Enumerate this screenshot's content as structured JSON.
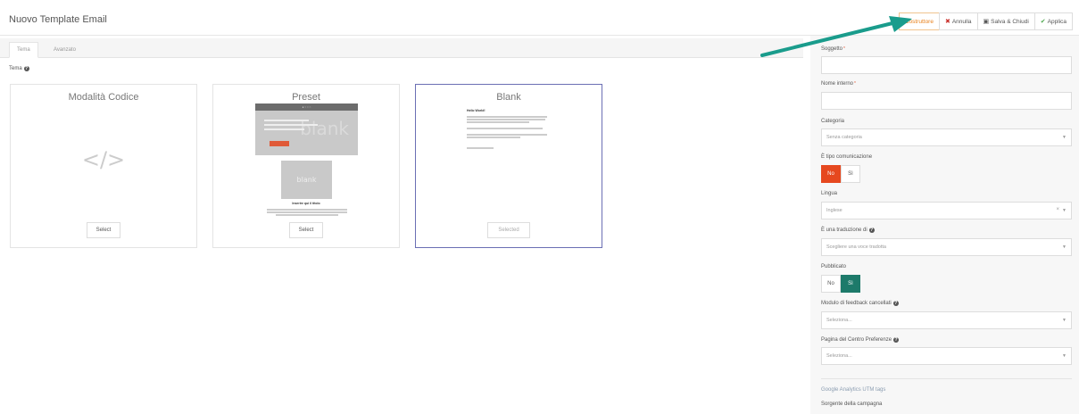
{
  "header": {
    "title": "Nuovo Template Email",
    "buttons": {
      "builder": "Costruttore",
      "cancel": "Annulla",
      "save_close": "Salva & Chiudi",
      "apply": "Applica"
    }
  },
  "tabs": [
    "Tema",
    "Avanzato"
  ],
  "theme_label": "Tema",
  "cards": [
    {
      "title": "Modalità Codice",
      "button": "Select"
    },
    {
      "title": "Preset",
      "button": "Select",
      "hero_text": "blank",
      "image_text": "blank",
      "heading": "Inserire qui il titolo"
    },
    {
      "title": "Blank",
      "button": "Selected",
      "heading": "Hello World!"
    }
  ],
  "form": {
    "subject_label": "Soggetto",
    "subject_value": "",
    "internal_name_label": "Nome interno",
    "internal_name_value": "",
    "category_label": "Categoria",
    "category_value": "Senza categoria",
    "comm_type_label": "È tipo comunicazione",
    "comm_type_no": "No",
    "comm_type_yes": "Sì",
    "language_label": "Lingua",
    "language_value": "Inglese",
    "translation_label": "È una traduzione di",
    "translation_placeholder": "Scegliere una voce tradotta",
    "published_label": "Pubblicato",
    "published_no": "No",
    "published_yes": "Sì",
    "unsub_label": "Modulo di feedback cancellati",
    "unsub_placeholder": "Seleziona...",
    "pref_label": "Pagina del Centro Preferenze",
    "pref_placeholder": "Seleziona...",
    "utm_label": "Google Analytics UTM tags",
    "source_label": "Sorgente della campagna"
  },
  "colors": {
    "builder_accent": "#e8811b",
    "toggle_no_active": "#e6481f",
    "toggle_yes_active": "#1d7a6a",
    "arrow": "#1a9c8c",
    "selected_card_border": "#6b6fb4"
  }
}
